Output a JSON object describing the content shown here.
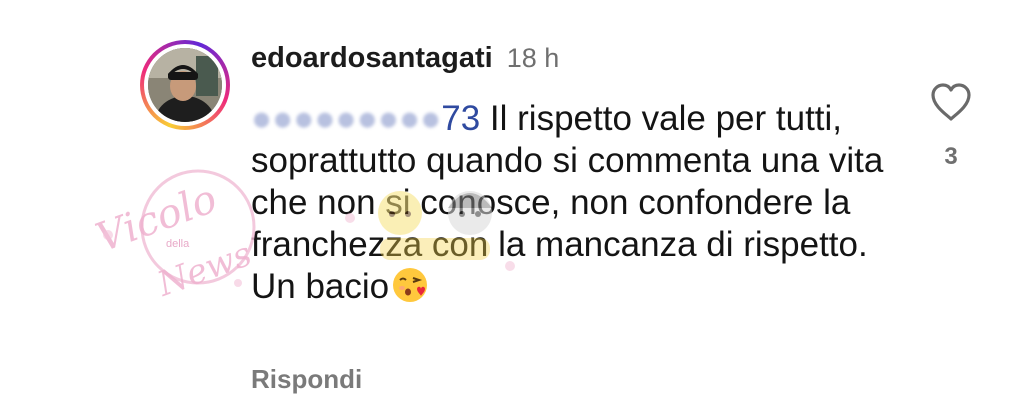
{
  "comment": {
    "username": "edoardosantagati",
    "time": "18 h",
    "mention_visible": "73",
    "text": " Il rispetto vale per tutti, soprattutto quando si commenta una vita che non si conosce, non confondere la franchezza con la mancanza di rispetto. Un bacio",
    "emoji": "face-blowing-a-kiss"
  },
  "actions": {
    "reply_label": "Rispondi",
    "like_count": "3",
    "like_icon": "heart-outline-icon"
  },
  "watermark": {
    "line1": "Vicolo",
    "line2": "della",
    "line3": "News"
  },
  "colors": {
    "mention": "#2f4aa0",
    "secondary_text": "#6f6f6f",
    "watermark": "#e9a8c8"
  }
}
